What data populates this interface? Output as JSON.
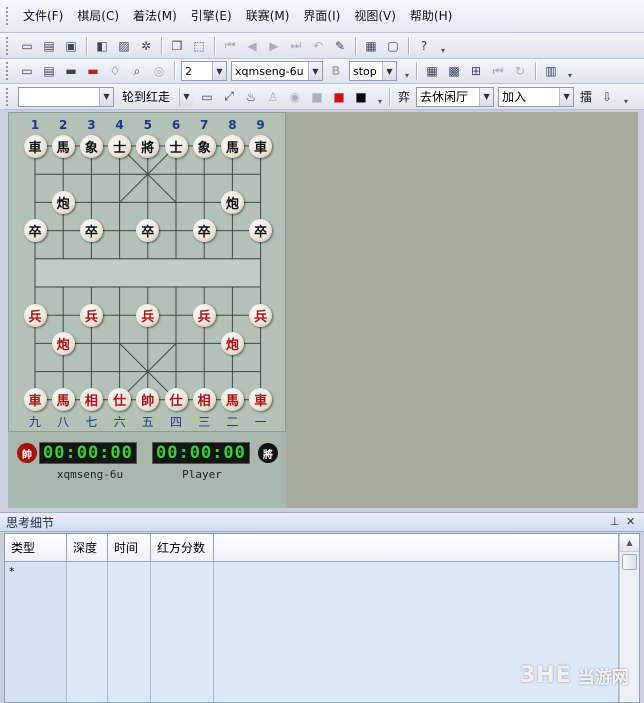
{
  "menu": [
    "文件(F)",
    "棋局(C)",
    "着法(M)",
    "引擎(E)",
    "联赛(M)",
    "界面(I)",
    "视图(V)",
    "帮助(H)"
  ],
  "toolbar1": {
    "icons": [
      "new-icon",
      "open-icon",
      "save-icon",
      "film-icon",
      "image-icon",
      "gear-icon",
      "copy-icon",
      "capture-icon",
      "first-move-icon",
      "prev-move-icon",
      "next-move-icon",
      "last-move-icon",
      "undo-icon",
      "analyze-icon",
      "board-icon",
      "paste-icon",
      "help-icon"
    ]
  },
  "toolbar2": {
    "depth_value": "2",
    "engine_value": "xqmseng-6u",
    "bold_label": "B",
    "stop_value": "stop"
  },
  "toolbar3": {
    "blank_combo_value": "",
    "turn_value": "轮到红走",
    "hall_label": "弈",
    "hall_value": "去休闲厅",
    "join_value": "加入",
    "push_label": "擂"
  },
  "board": {
    "file_numbers_top": [
      "1",
      "2",
      "3",
      "4",
      "5",
      "6",
      "7",
      "8",
      "9"
    ],
    "file_numbers_bottom": [
      "九",
      "八",
      "七",
      "六",
      "五",
      "四",
      "三",
      "二",
      "一"
    ],
    "black_back_rank": [
      "車",
      "馬",
      "象",
      "士",
      "將",
      "士",
      "象",
      "馬",
      "車"
    ],
    "black_cannon": "炮",
    "black_pawn": "卒",
    "red_back_rank": [
      "車",
      "馬",
      "相",
      "仕",
      "帥",
      "仕",
      "相",
      "馬",
      "車"
    ],
    "red_cannon": "炮",
    "red_pawn": "兵"
  },
  "players": {
    "red_badge": "帥",
    "black_badge": "將",
    "red_clock": "00:00:00",
    "black_clock": "00:00:00",
    "red_name": "xqmseng-6u",
    "black_name": "Player"
  },
  "think_panel": {
    "title": "思考细节",
    "pin_icon": "pin-icon",
    "close_icon": "close-icon",
    "columns": [
      "类型",
      "深度",
      "时间",
      "红方分数",
      ""
    ],
    "rows": [
      [
        "*",
        "",
        "",
        "",
        ""
      ],
      [
        "",
        "",
        "",
        "",
        ""
      ],
      [
        "",
        "",
        "",
        "",
        ""
      ],
      [
        "",
        "",
        "",
        "",
        ""
      ],
      [
        "",
        "",
        "",
        "",
        ""
      ]
    ]
  },
  "watermark": {
    "logo_text": "3HE",
    "site_text": "当游网"
  },
  "colors": {
    "board_bg": "#b4c2b6",
    "side_area": "#a6ab9c",
    "red_piece_text": "#b01010",
    "clock_digits": "#38d238"
  }
}
